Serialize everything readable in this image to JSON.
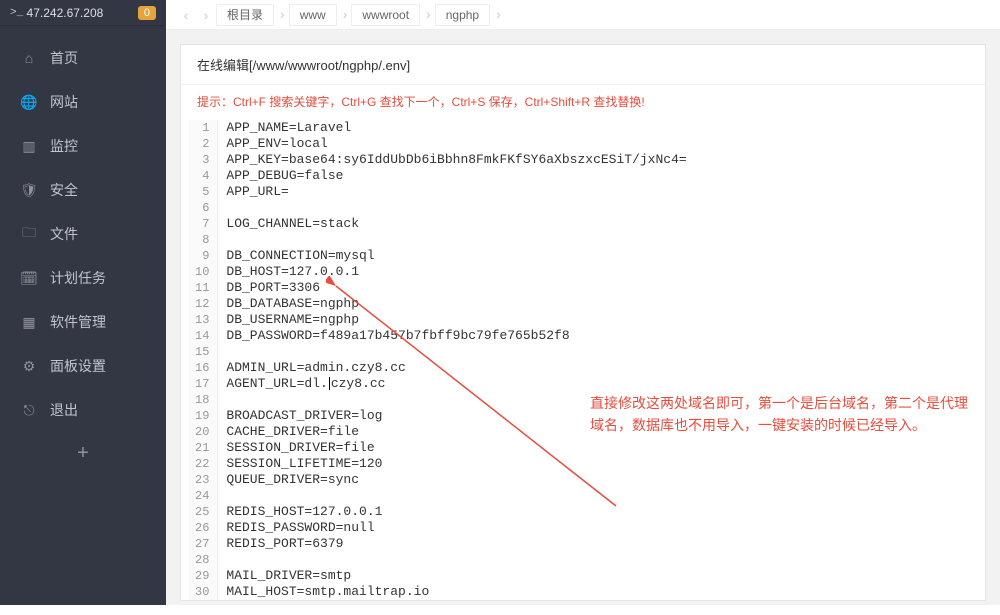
{
  "sidebar": {
    "ip": "47.242.67.208",
    "badge": "0",
    "items": [
      {
        "icon": "home",
        "label": "首页"
      },
      {
        "icon": "globe",
        "label": "网站"
      },
      {
        "icon": "chart",
        "label": "监控"
      },
      {
        "icon": "shield",
        "label": "安全"
      },
      {
        "icon": "folder",
        "label": "文件"
      },
      {
        "icon": "clock",
        "label": "计划任务"
      },
      {
        "icon": "grid",
        "label": "软件管理"
      },
      {
        "icon": "gear",
        "label": "面板设置"
      },
      {
        "icon": "exit",
        "label": "退出"
      }
    ]
  },
  "breadcrumb": {
    "parts": [
      "根目录",
      "www",
      "wwwroot",
      "ngphp"
    ]
  },
  "editor": {
    "title": "在线编辑[/www/wwwroot/ngphp/.env]",
    "hint": "提示：Ctrl+F 搜索关键字，Ctrl+G 查找下一个，Ctrl+S 保存，Ctrl+Shift+R 查找替换!",
    "lines": [
      "APP_NAME=Laravel",
      "APP_ENV=local",
      "APP_KEY=base64:sy6IddUbDb6iBbhn8FmkFKfSY6aXbszxcESiT/jxNc4=",
      "APP_DEBUG=false",
      "APP_URL=",
      "",
      "LOG_CHANNEL=stack",
      "",
      "DB_CONNECTION=mysql",
      "DB_HOST=127.0.0.1",
      "DB_PORT=3306",
      "DB_DATABASE=ngphp",
      "DB_USERNAME=ngphp",
      "DB_PASSWORD=f489a17b457b7fbff9bc79fe765b52f8",
      "",
      "ADMIN_URL=admin.czy8.cc",
      "AGENT_URL=dl.czy8.cc",
      "",
      "BROADCAST_DRIVER=log",
      "CACHE_DRIVER=file",
      "SESSION_DRIVER=file",
      "SESSION_LIFETIME=120",
      "QUEUE_DRIVER=sync",
      "",
      "REDIS_HOST=127.0.0.1",
      "REDIS_PASSWORD=null",
      "REDIS_PORT=6379",
      "",
      "MAIL_DRIVER=smtp",
      "MAIL_HOST=smtp.mailtrap.io"
    ],
    "cursor_line": 17,
    "cursor_col": 13
  },
  "annotation": {
    "text": "直接修改这两处域名即可，第一个是后台域名，第二个是代理域名，数据库也不用导入，一键安装的时候已经导入。"
  }
}
